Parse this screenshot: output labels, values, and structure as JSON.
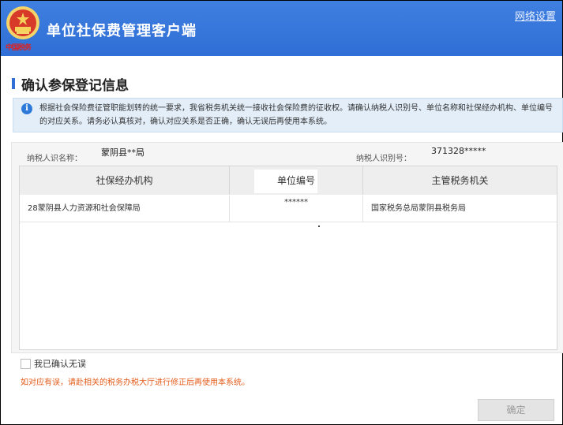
{
  "header": {
    "app_title": "单位社保费管理客户端",
    "network_settings": "网络设置"
  },
  "page": {
    "title": "确认参保登记信息"
  },
  "notice": {
    "text": "根据社会保险费征管职能划转的统一要求，我省税务机关统一接收社会保险费的征收权。请确认纳税人识别号、单位名称和社保经办机构、单位编号的对应关系。请务必认真核对，确认对应关系是否正确，确认无误后再使用本系统。"
  },
  "taxpayer": {
    "name_label": "纳税人识名称：",
    "name_value": "蒙阴县**局",
    "id_label": "纳税人识别号：",
    "id_value": "371328*****"
  },
  "table": {
    "headers": [
      "社保经办机构",
      "单位编号",
      "主管税务机关"
    ],
    "rows": [
      [
        "28蒙阴县人力资源和社会保障局",
        "******",
        "国家税务总局蒙阴县税务局"
      ]
    ]
  },
  "footer": {
    "confirm_checkbox_label": "我已确认无误",
    "warning": "如对应有误，请赴相关的税务办税大厅进行修正后再使用本系统。",
    "confirm_button": "确定"
  }
}
